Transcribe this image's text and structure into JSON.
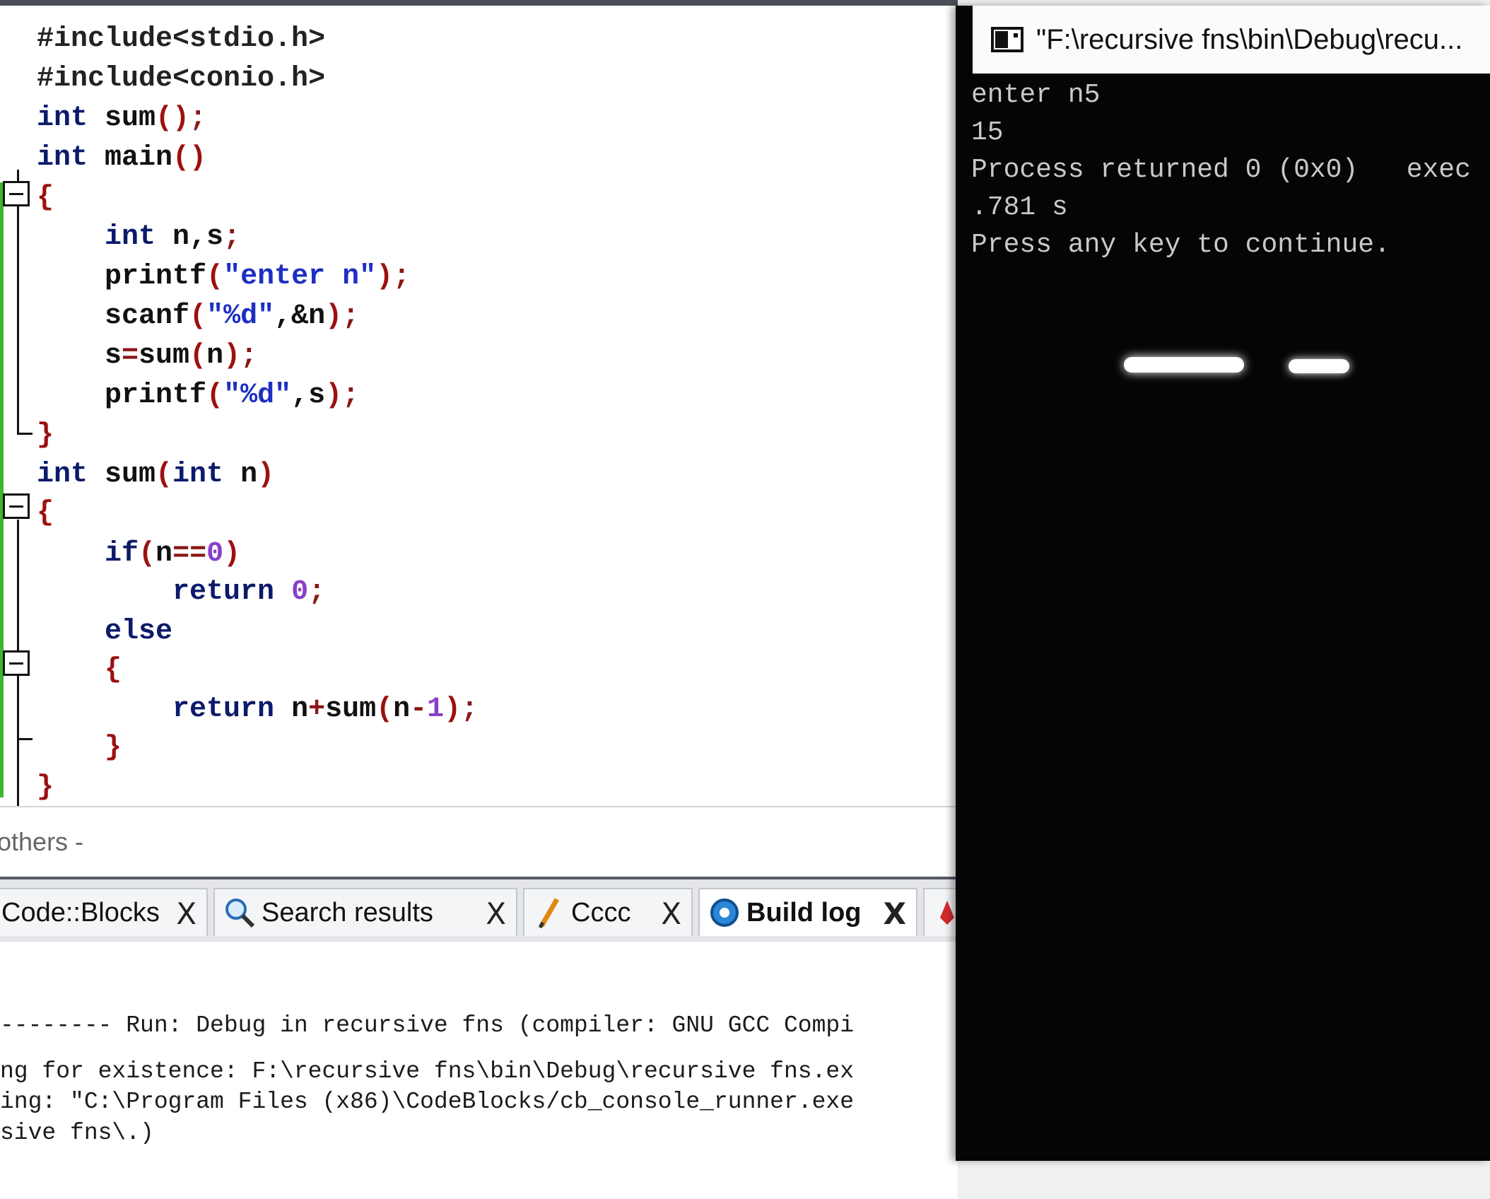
{
  "editor": {
    "lines": [
      [
        [
          "pp",
          "#include<stdio.h>"
        ]
      ],
      [
        [
          "pp",
          "#include<conio.h>"
        ]
      ],
      [
        [
          "kw",
          "int"
        ],
        [
          "tx",
          " sum"
        ],
        [
          "br",
          "()"
        ],
        [
          "op",
          ";"
        ]
      ],
      [
        [
          "kw",
          "int"
        ],
        [
          "tx",
          " main"
        ],
        [
          "br",
          "()"
        ]
      ],
      [
        [
          "br",
          "{"
        ]
      ],
      [
        [
          "tx",
          "    "
        ],
        [
          "kw",
          "int"
        ],
        [
          "tx",
          " n,s"
        ],
        [
          "op",
          ";"
        ]
      ],
      [
        [
          "tx",
          "    printf"
        ],
        [
          "br",
          "("
        ],
        [
          "st",
          "\"enter n\""
        ],
        [
          "br",
          ")"
        ],
        [
          "op",
          ";"
        ]
      ],
      [
        [
          "tx",
          "    scanf"
        ],
        [
          "br",
          "("
        ],
        [
          "st",
          "\"%d\""
        ],
        [
          "tx",
          ",&n"
        ],
        [
          "br",
          ")"
        ],
        [
          "op",
          ";"
        ]
      ],
      [
        [
          "tx",
          "    s"
        ],
        [
          "op",
          "="
        ],
        [
          "tx",
          "sum"
        ],
        [
          "br",
          "("
        ],
        [
          "tx",
          "n"
        ],
        [
          "br",
          ")"
        ],
        [
          "op",
          ";"
        ]
      ],
      [
        [
          "tx",
          "    printf"
        ],
        [
          "br",
          "("
        ],
        [
          "st",
          "\"%d\""
        ],
        [
          "tx",
          ",s"
        ],
        [
          "br",
          ")"
        ],
        [
          "op",
          ";"
        ]
      ],
      [
        [
          "br",
          "}"
        ]
      ],
      [
        [
          "kw",
          "int"
        ],
        [
          "tx",
          " sum"
        ],
        [
          "br",
          "("
        ],
        [
          "kw",
          "int"
        ],
        [
          "tx",
          " n"
        ],
        [
          "br",
          ")"
        ]
      ],
      [
        [
          "br",
          "{"
        ]
      ],
      [
        [
          "tx",
          "    "
        ],
        [
          "kw",
          "if"
        ],
        [
          "br",
          "("
        ],
        [
          "tx",
          "n"
        ],
        [
          "op",
          "=="
        ],
        [
          "nm",
          "0"
        ],
        [
          "br",
          ")"
        ]
      ],
      [
        [
          "tx",
          "        "
        ],
        [
          "kw",
          "return"
        ],
        [
          "tx",
          " "
        ],
        [
          "nm",
          "0"
        ],
        [
          "op",
          ";"
        ]
      ],
      [
        [
          "tx",
          "    "
        ],
        [
          "kw",
          "else"
        ]
      ],
      [
        [
          "tx",
          "    "
        ],
        [
          "br",
          "{"
        ]
      ],
      [
        [
          "tx",
          "        "
        ],
        [
          "kw",
          "return"
        ],
        [
          "tx",
          " n"
        ],
        [
          "op",
          "+"
        ],
        [
          "tx",
          "sum"
        ],
        [
          "br",
          "("
        ],
        [
          "tx",
          "n"
        ],
        [
          "op",
          "-"
        ],
        [
          "nm",
          "1"
        ],
        [
          "br",
          ")"
        ],
        [
          "op",
          ";"
        ]
      ],
      [
        [
          "tx",
          "    "
        ],
        [
          "br",
          "}"
        ]
      ],
      [
        [
          "br",
          "}"
        ]
      ]
    ]
  },
  "filter": {
    "label": "others -"
  },
  "tabs": [
    {
      "label": "Code::Blocks",
      "icon": "codeblocks-icon",
      "active": false
    },
    {
      "label": "Search results",
      "icon": "magnifier-icon",
      "active": false
    },
    {
      "label": "Cccc",
      "icon": "pencil-icon",
      "active": false
    },
    {
      "label": "Build log",
      "icon": "build-gear-icon",
      "active": true
    }
  ],
  "tab_close_glyph": "X",
  "log": {
    "lines": [
      "-------- Run: Debug in recursive fns (compiler: GNU GCC Compi",
      "ng for existence: F:\\recursive fns\\bin\\Debug\\recursive fns.ex",
      "ing: \"C:\\Program Files (x86)\\CodeBlocks/cb_console_runner.exe",
      "sive fns\\.)"
    ]
  },
  "console": {
    "title": "\"F:\\recursive fns\\bin\\Debug\\recu...",
    "lines": [
      "enter n5",
      "15",
      "Process returned 0 (0x0)   exec",
      ".781 s",
      "Press any key to continue."
    ]
  },
  "colors": {
    "keyword": "#0c1a6a",
    "string": "#1d2fc2",
    "bracket": "#9c1010",
    "number": "#8a3fc9",
    "console_bg": "#050505",
    "console_text": "#c9c9c9",
    "change_bar": "#38b82a"
  }
}
